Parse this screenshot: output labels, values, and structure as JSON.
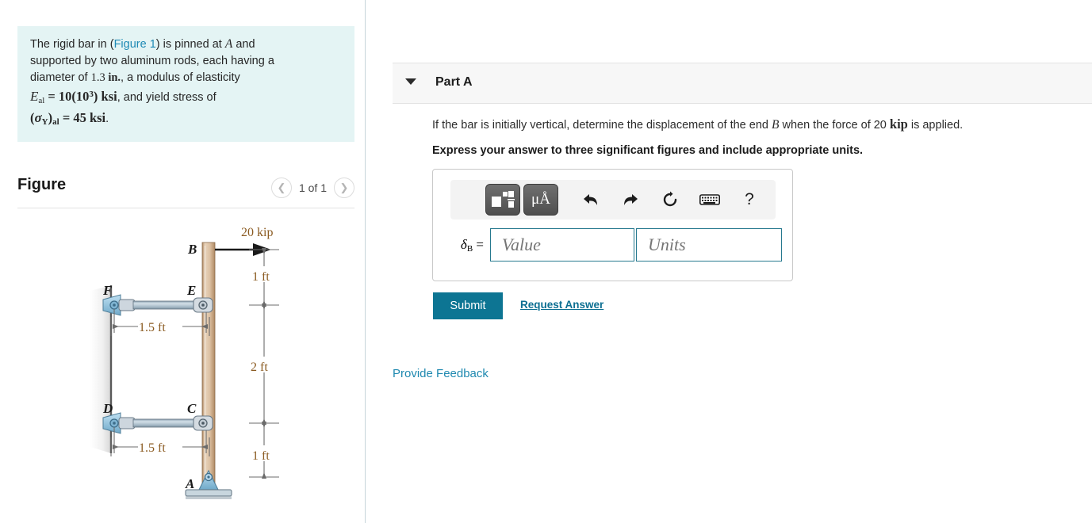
{
  "problem": {
    "lines": [
      "The rigid bar in (Figure 1) is pinned at A and",
      "supported by two aluminum rods, each having a",
      "diameter of 1.3 in., a modulus of elasticity",
      "Eal = 10(10^3) ksi, and yield stress of",
      "(σY)al = 45 ksi."
    ],
    "figure_link_text": "Figure 1",
    "diameter_value": "1.3",
    "diameter_unit": "in.",
    "modulus_symbol": "E",
    "modulus_subscript": "al",
    "modulus_value": "10(10",
    "modulus_exponent": "3",
    "modulus_unit": "ksi",
    "yield_symbol": "σ",
    "yield_subscript_y": "Y",
    "yield_subscript_al": "al",
    "yield_value": "45",
    "yield_unit": "ksi"
  },
  "figure": {
    "title": "Figure",
    "counter": "1 of 1",
    "prev_icon": "chevron-left-icon",
    "next_icon": "chevron-right-icon",
    "labels": {
      "force": "20 kip",
      "point_a": "A",
      "point_b": "B",
      "point_c": "C",
      "point_d": "D",
      "point_e": "E",
      "point_f": "F",
      "dim_top": "1 ft",
      "dim_mid": "2 ft",
      "dim_bottom": "1 ft",
      "dim_upper_rod": "1.5 ft",
      "dim_lower_rod": "1.5 ft"
    }
  },
  "part_a": {
    "caret_icon": "caret-down-icon",
    "title": "Part A",
    "question_pre": "If the bar is initially vertical, determine the displacement of the end ",
    "question_var": "B",
    "question_mid": " when the force of 20 ",
    "question_unit": "kip",
    "question_post": " is applied.",
    "instruction": "Express your answer to three significant figures and include appropriate units."
  },
  "answer": {
    "toolbar": [
      {
        "name": "template-icon",
        "glyph": ""
      },
      {
        "name": "units-micro-angstrom-icon",
        "glyph": "μÅ"
      },
      {
        "name": "undo-icon",
        "glyph": "↰"
      },
      {
        "name": "redo-icon",
        "glyph": "↱"
      },
      {
        "name": "reset-icon",
        "glyph": "↻"
      },
      {
        "name": "keyboard-icon",
        "glyph": "⌨"
      },
      {
        "name": "help-icon",
        "glyph": "?"
      }
    ],
    "label_symbol": "δ",
    "label_subscript": "B",
    "label_equals": "=",
    "value_placeholder": "Value",
    "value_current": "",
    "units_placeholder": "Units",
    "units_current": "",
    "submit_label": "Submit",
    "request_answer_label": "Request Answer"
  },
  "footer": {
    "feedback_label": "Provide Feedback"
  },
  "colors": {
    "problem_bg": "#e4f4f4",
    "link": "#1f89b0",
    "submit_bg": "#0d7593",
    "input_border": "#26798f",
    "dim_text": "#8a5a20",
    "bar_fill": "#d9bfa3",
    "rod_fill": "#b8c8d4",
    "support_fill": "#8fc3de"
  }
}
